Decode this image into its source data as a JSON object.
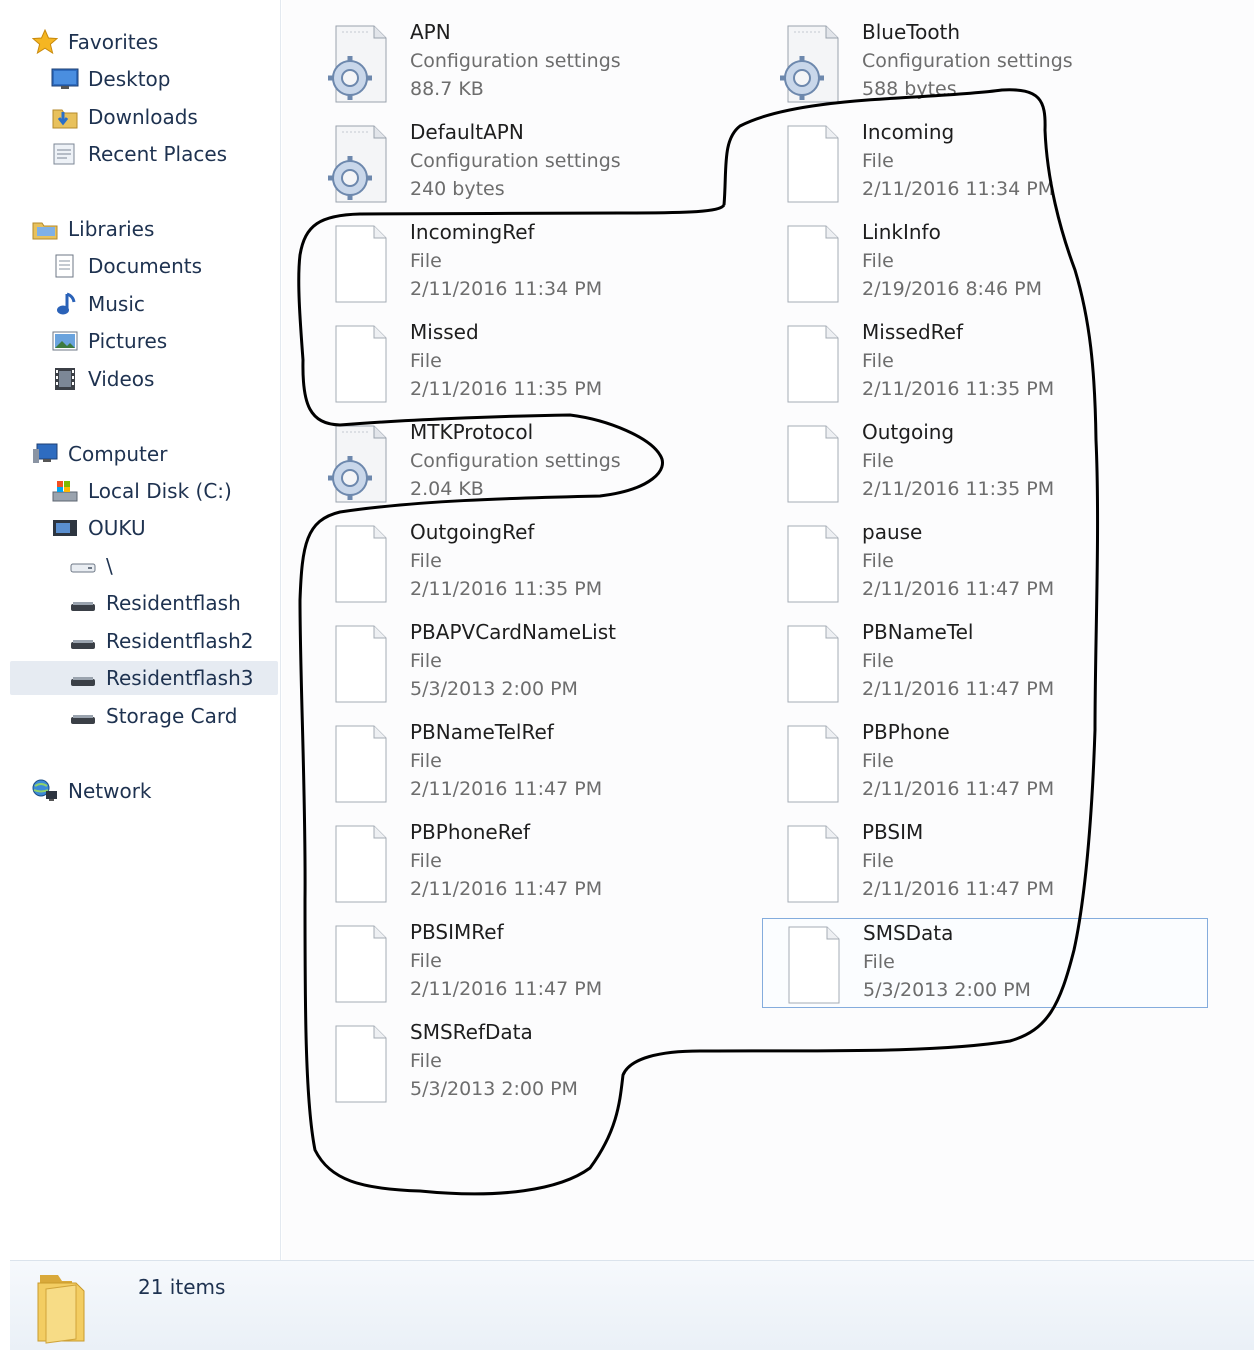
{
  "nav": {
    "favorites": "Favorites",
    "desktop": "Desktop",
    "downloads": "Downloads",
    "recent_places": "Recent Places",
    "libraries": "Libraries",
    "documents": "Documents",
    "music": "Music",
    "pictures": "Pictures",
    "videos": "Videos",
    "computer": "Computer",
    "local_disk": "Local Disk (C:)",
    "ouku": "OUKU",
    "root": "\\",
    "residentflash": "Residentflash",
    "residentflash2": "Residentflash2",
    "residentflash3": "Residentflash3",
    "storage_card": "Storage Card",
    "network": "Network",
    "selected": "Residentflash3"
  },
  "files": [
    {
      "name": "APN",
      "type": "Configuration settings",
      "meta": "88.7 KB",
      "icon": "config-file-icon"
    },
    {
      "name": "BlueTooth",
      "type": "Configuration settings",
      "meta": "588 bytes",
      "icon": "config-file-icon"
    },
    {
      "name": "DefaultAPN",
      "type": "Configuration settings",
      "meta": "240 bytes",
      "icon": "config-file-icon"
    },
    {
      "name": "Incoming",
      "type": "File",
      "meta": "2/11/2016 11:34 PM",
      "icon": "blank-file-icon"
    },
    {
      "name": "IncomingRef",
      "type": "File",
      "meta": "2/11/2016 11:34 PM",
      "icon": "blank-file-icon"
    },
    {
      "name": "LinkInfo",
      "type": "File",
      "meta": "2/19/2016 8:46 PM",
      "icon": "blank-file-icon"
    },
    {
      "name": "Missed",
      "type": "File",
      "meta": "2/11/2016 11:35 PM",
      "icon": "blank-file-icon"
    },
    {
      "name": "MissedRef",
      "type": "File",
      "meta": "2/11/2016 11:35 PM",
      "icon": "blank-file-icon"
    },
    {
      "name": "MTKProtocol",
      "type": "Configuration settings",
      "meta": "2.04 KB",
      "icon": "config-file-icon"
    },
    {
      "name": "Outgoing",
      "type": "File",
      "meta": "2/11/2016 11:35 PM",
      "icon": "blank-file-icon"
    },
    {
      "name": "OutgoingRef",
      "type": "File",
      "meta": "2/11/2016 11:35 PM",
      "icon": "blank-file-icon"
    },
    {
      "name": "pause",
      "type": "File",
      "meta": "2/11/2016 11:47 PM",
      "icon": "blank-file-icon"
    },
    {
      "name": "PBAPVCardNameList",
      "type": "File",
      "meta": "5/3/2013 2:00 PM",
      "icon": "blank-file-icon"
    },
    {
      "name": "PBNameTel",
      "type": "File",
      "meta": "2/11/2016 11:47 PM",
      "icon": "blank-file-icon"
    },
    {
      "name": "PBNameTelRef",
      "type": "File",
      "meta": "2/11/2016 11:47 PM",
      "icon": "blank-file-icon"
    },
    {
      "name": "PBPhone",
      "type": "File",
      "meta": "2/11/2016 11:47 PM",
      "icon": "blank-file-icon"
    },
    {
      "name": "PBPhoneRef",
      "type": "File",
      "meta": "2/11/2016 11:47 PM",
      "icon": "blank-file-icon"
    },
    {
      "name": "PBSIM",
      "type": "File",
      "meta": "2/11/2016 11:47 PM",
      "icon": "blank-file-icon"
    },
    {
      "name": "PBSIMRef",
      "type": "File",
      "meta": "2/11/2016 11:47 PM",
      "icon": "blank-file-icon"
    },
    {
      "name": "SMSData",
      "type": "File",
      "meta": "5/3/2013 2:00 PM",
      "icon": "blank-file-icon",
      "selected": true
    },
    {
      "name": "SMSRefData",
      "type": "File",
      "meta": "5/3/2013 2:00 PM",
      "icon": "blank-file-icon"
    }
  ],
  "status": {
    "item_count": "21 items"
  },
  "colors": {
    "selection_border": "#84acdd",
    "annotation_stroke": "#000000",
    "nav_selected": "#e6ebf2"
  }
}
